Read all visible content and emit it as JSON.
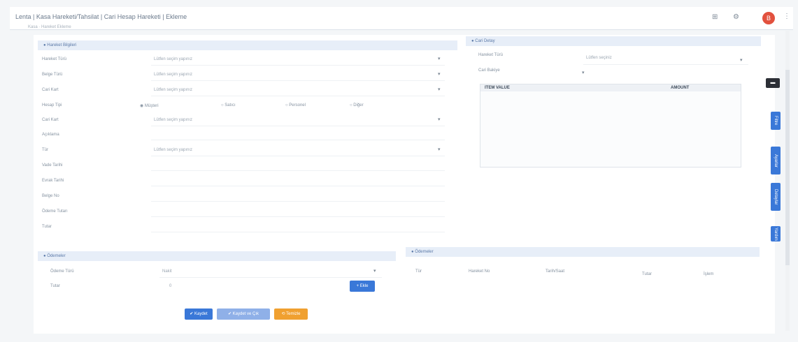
{
  "header": {
    "title": "Lenta | Kasa Hareketi/Tahsilat | Cari Hesap Hareketi | Ekleme",
    "breadcrumb": "Kasa · Hareket Ekleme",
    "icons": [
      "grid-icon",
      "settings-icon",
      "avatar",
      "more-icon"
    ],
    "avatar_initial": "B"
  },
  "left_panel": {
    "title": "Hareket Bilgileri",
    "fields": [
      {
        "label": "Hareket Türü",
        "value": "Lütfen seçim yapınız",
        "dropdown": true
      },
      {
        "label": "Belge Türü",
        "value": "Lütfen seçim yapınız",
        "dropdown": true
      },
      {
        "label": "Cari Kart",
        "value": "Lütfen seçim yapınız",
        "dropdown": true
      },
      {
        "label": "Hesap Tipi",
        "value": "",
        "dropdown": false
      },
      {
        "label": "Cari Kart",
        "value": "Lütfen seçim yapınız",
        "dropdown": true
      },
      {
        "label": "Açıklama",
        "value": "",
        "dropdown": false
      },
      {
        "label": "Tür",
        "value": "Lütfen seçim yapınız",
        "dropdown": true
      },
      {
        "label": "Vade Tarihi",
        "value": "",
        "dropdown": false
      },
      {
        "label": "Evrak Tarihi",
        "value": "",
        "dropdown": false
      },
      {
        "label": "Belge No",
        "value": "",
        "dropdown": false
      },
      {
        "label": "Ödeme Tutarı",
        "value": "",
        "dropdown": false
      },
      {
        "label": "Tutar",
        "value": "",
        "dropdown": false
      }
    ],
    "radio_options": [
      "Müşteri",
      "Satıcı",
      "Personel",
      "Diğer"
    ]
  },
  "right_panel": {
    "title": "Cari Detay",
    "fields": [
      {
        "label": "Hareket Türü",
        "value": "Lütfen seçiniz"
      },
      {
        "label": "Cari Bakiye",
        "value": ""
      }
    ],
    "table_headers": [
      "ITEM VALUE",
      "AMOUNT"
    ]
  },
  "bottom_left": {
    "title": "Ödemeler",
    "fields": [
      {
        "label": "Ödeme Türü",
        "value": "Nakit"
      },
      {
        "label": "Tutar",
        "value": "0"
      }
    ],
    "add_button": "Ekle"
  },
  "bottom_right": {
    "title": "Ödemeler",
    "headers": [
      "Tür",
      "Hareket No",
      "Tarih/Saat",
      "Tutar",
      "İşlem"
    ]
  },
  "buttons": {
    "save": "Kaydet",
    "save_and_close": "Kaydet ve Çık",
    "clear": "Temizle"
  },
  "side_tabs": [
    "Filtre",
    "Ayarlar",
    "Detaylar",
    "Yardım"
  ],
  "colors": {
    "primary": "#3a78d8",
    "primary_light": "#8fb0e8",
    "warning": "#f0a030",
    "panel_header": "#e7eef8",
    "avatar": "#e2513e"
  }
}
